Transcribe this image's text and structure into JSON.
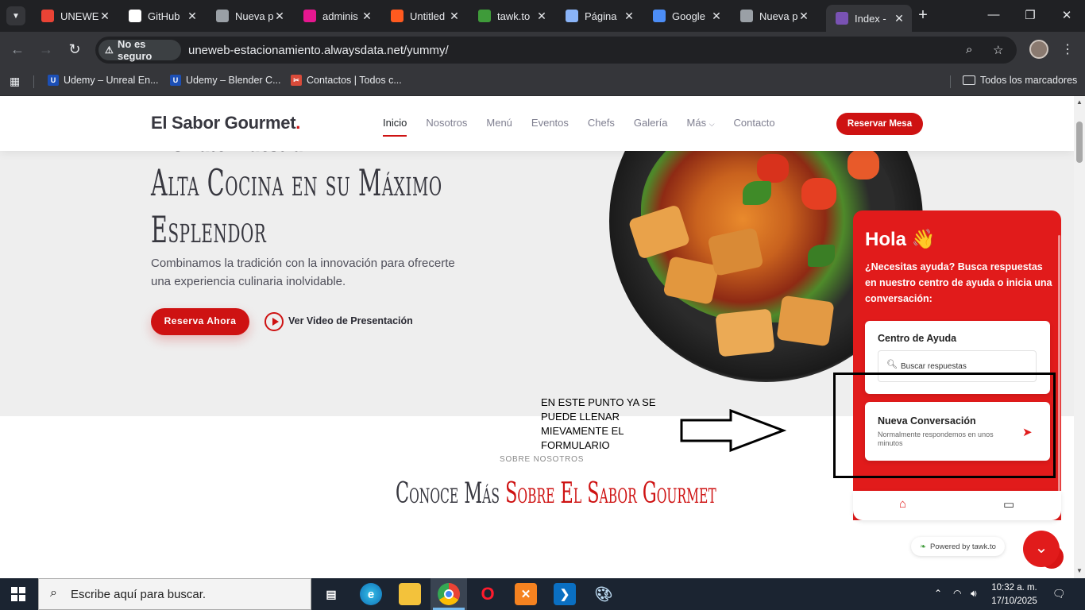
{
  "browser": {
    "tabs": [
      {
        "title": "UNEWE",
        "icon": "gmail-icon",
        "color": "#ea4335"
      },
      {
        "title": "GitHub",
        "icon": "github-icon",
        "color": "#ffffff"
      },
      {
        "title": "Nueva p",
        "icon": "chrome-icon",
        "color": "#9aa0a6"
      },
      {
        "title": "adminis",
        "icon": "wave-icon",
        "color": "#e5178f"
      },
      {
        "title": "Untitled",
        "icon": "orange-square-icon",
        "color": "#ff5a1f"
      },
      {
        "title": "tawk.to",
        "icon": "tawk-icon",
        "color": "#3f9b3a"
      },
      {
        "title": "Página",
        "icon": "globe-icon",
        "color": "#8ab4f8"
      },
      {
        "title": "Google",
        "icon": "gemini-icon",
        "color": "#4c8df6"
      },
      {
        "title": "Nueva p",
        "icon": "chrome-icon",
        "color": "#9aa0a6"
      },
      {
        "title": "Index -",
        "icon": "bootstrap-icon",
        "color": "#7952b3",
        "active": true
      }
    ],
    "security_label": "No es seguro",
    "url": "uneweb-estacionamiento.alwaysdata.net/yummy/",
    "bookmarks": [
      {
        "label": "Udemy – Unreal En...",
        "color": "#1c4fb5"
      },
      {
        "label": "Udemy – Blender C...",
        "color": "#1c4fb5"
      },
      {
        "label": "Contactos | Todos c...",
        "color": "#d94b3a"
      }
    ],
    "all_bookmarks": "Todos los marcadores"
  },
  "site": {
    "logo_text": "El Sabor Gourmet",
    "logo_dot": ".",
    "nav": [
      "Inicio",
      "Nosotros",
      "Menú",
      "Eventos",
      "Chefs",
      "Galería",
      "Más",
      "Contacto"
    ],
    "nav_more_caret": "⌵",
    "reserve_button": "Reservar Mesa",
    "hero_cut_text": "Disfrute Nuestra",
    "hero_title_line1": "Alta Cocina en su Máximo",
    "hero_title_line2": "Esplendor",
    "hero_subtitle": "Combinamos la tradición con la innovación para ofrecerte una experiencia culinaria inolvidable.",
    "hero_button": "Reserva Ahora",
    "video_link": "Ver Video de Presentación",
    "section_label": "SOBRE NOSOTROS",
    "section_title_a": "Conoce Más ",
    "section_title_b": "Sobre El Sabor Gourmet"
  },
  "annotation": {
    "note": "EN ESTE PUNTO YA SE PUEDE LLENAR MIEVAMENTE EL FORMULARIO"
  },
  "tawk": {
    "greeting": "Hola 👋",
    "intro": "¿Necesitas ayuda? Busca respuestas en nuestro centro de ayuda o inicia una conversación:",
    "help_center_title": "Centro de Ayuda",
    "search_placeholder": "Buscar respuestas",
    "new_conv_title": "Nueva Conversación",
    "new_conv_sub": "Normalmente respondemos en unos minutos",
    "powered": "Powered by tawk.to",
    "brand_color": "#e11b1b"
  },
  "taskbar": {
    "search_text": "Escribe aquí para buscar.",
    "time": "10:32 a. m.",
    "date": "17/10/2025"
  }
}
